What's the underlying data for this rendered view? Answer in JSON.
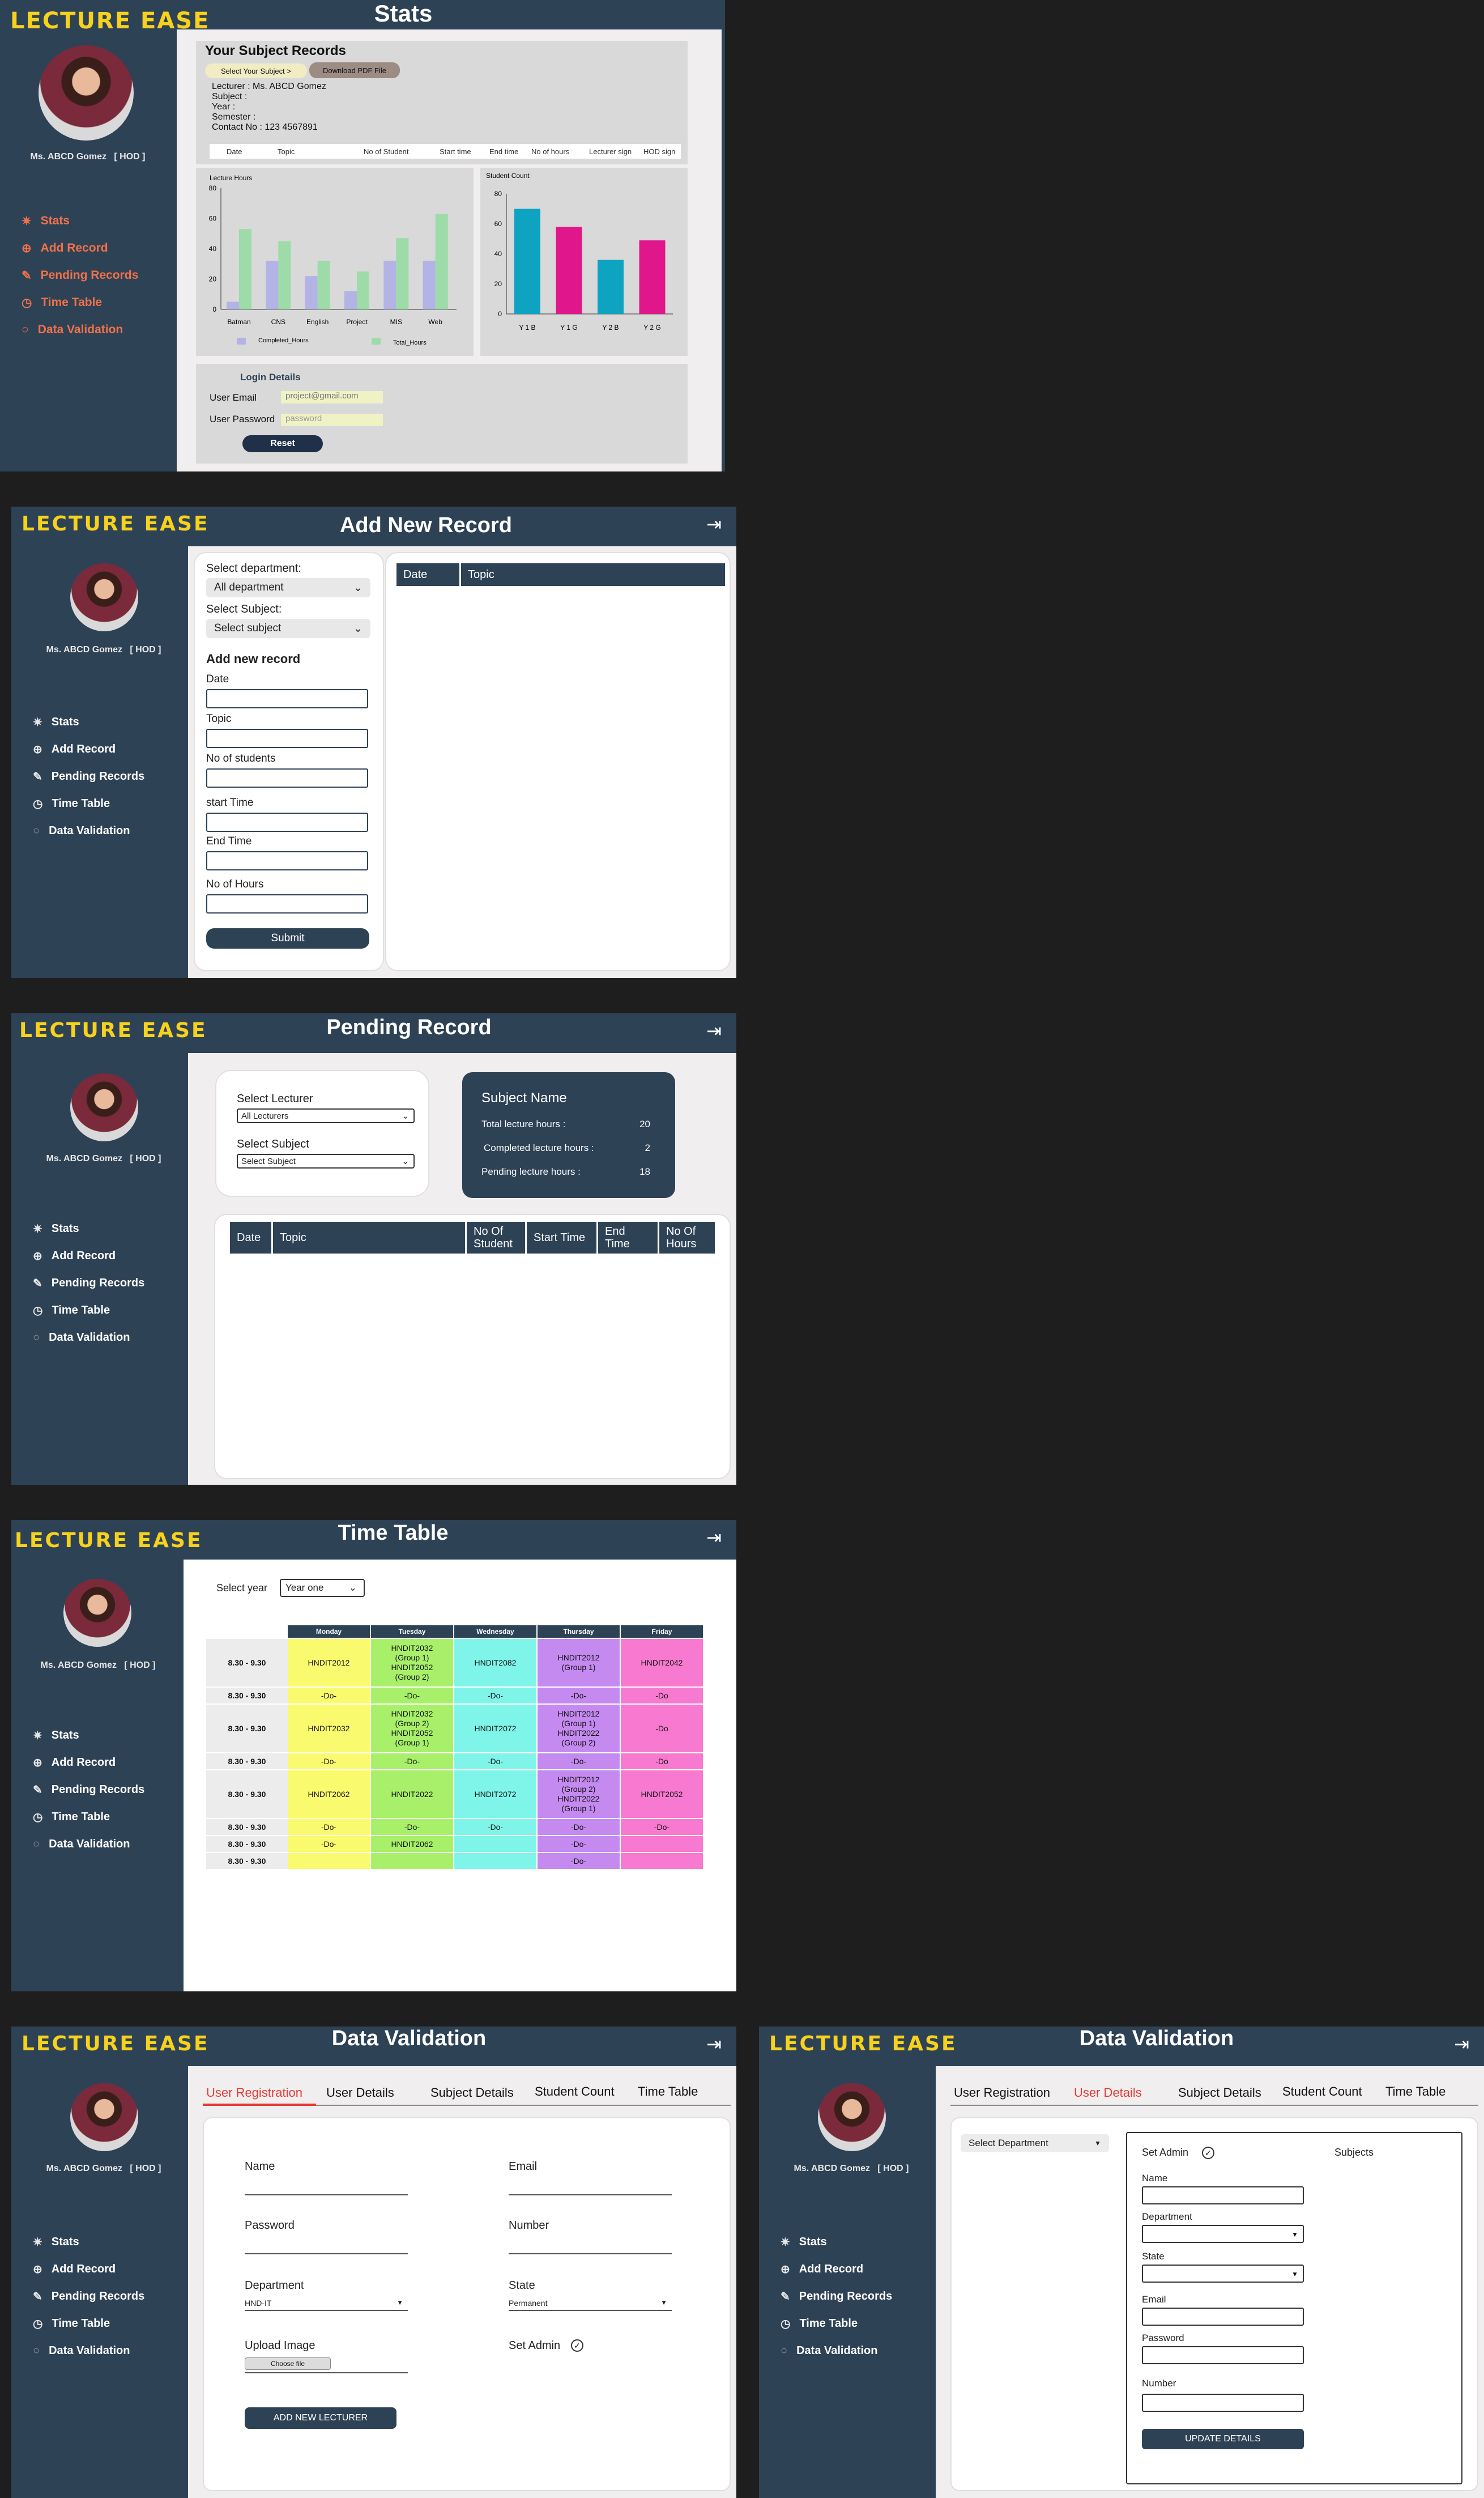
{
  "brand": {
    "name": "LECTURE EASE",
    "color": "#f7d21c"
  },
  "user": {
    "name": "Ms. ABCD Gomez",
    "role": "[ HOD ]"
  },
  "menu": [
    {
      "label": "Stats",
      "icon": "star-icon"
    },
    {
      "label": "Add Record",
      "icon": "plus-circle-icon"
    },
    {
      "label": "Pending Records",
      "icon": "edit-icon"
    },
    {
      "label": "Time Table",
      "icon": "clock-icon"
    },
    {
      "label": "Data Validation",
      "icon": "check-circle-icon"
    }
  ],
  "colors": {
    "sidebar": "#2e4256",
    "accent_orange": "#f0714a",
    "accent_red": "#e53935"
  },
  "stats": {
    "title": "Stats",
    "records_title": "Your Subject Records",
    "select_subject": "Select Your Subject >",
    "download_pdf": "Download PDF File",
    "lecturer_line": "Lecturer : Ms. ABCD Gomez",
    "subject_line": "Subject :",
    "year_line": "Year :",
    "semester_line": "Semester :",
    "contact_line": "Contact No : 123 4567891",
    "columns": [
      "Date",
      "Topic",
      "No of Student",
      "Start time",
      "End time",
      "No of hours",
      "Lecturer sign",
      "HOD sign"
    ],
    "login_title": "Login Details",
    "email_label": "User Email",
    "email_value": "project@gmail.com",
    "password_label": "User Password",
    "password_value": "password",
    "reset": "Reset"
  },
  "chart_data": [
    {
      "type": "bar",
      "title": "Lecture Hours",
      "categories": [
        "Batman",
        "CNS",
        "English",
        "Project",
        "MIS",
        "Web"
      ],
      "series": [
        {
          "name": "Completed_Hours",
          "values": [
            5,
            32,
            22,
            12,
            32,
            32
          ],
          "color": "#b3b3e6"
        },
        {
          "name": "Total_Hours",
          "values": [
            53,
            45,
            32,
            25,
            47,
            63
          ],
          "color": "#9ddba8"
        }
      ],
      "ylim": [
        0,
        80
      ],
      "yticks": [
        0,
        20,
        40,
        60,
        80
      ],
      "legend": "bottom"
    },
    {
      "type": "bar",
      "title": "Student Count",
      "categories": [
        "Y 1 B",
        "Y 1 G",
        "Y 2 B",
        "Y 2 G"
      ],
      "values": [
        70,
        58,
        36,
        49
      ],
      "colors": [
        "#0fa3c2",
        "#e0168b",
        "#0fa3c2",
        "#e0168b"
      ],
      "ylim": [
        0,
        80
      ],
      "yticks": [
        0,
        20,
        40,
        60,
        80
      ]
    }
  ],
  "add": {
    "title": "Add New Record",
    "dept_label": "Select department:",
    "dept_value": "All department",
    "subject_label": "Select Subject:",
    "subject_value": "Select subject",
    "form_title": "Add new record",
    "fields": [
      "Date",
      "Topic",
      "No of students",
      "start Time",
      "End Time",
      "No of Hours"
    ],
    "submit": "Submit",
    "columns": [
      "Date",
      "Topic"
    ]
  },
  "pending": {
    "title": "Pending Record",
    "lecturer_label": "Select Lecturer",
    "lecturer_value": "All Lecturers",
    "subject_label": "Select Subject",
    "subject_value": "Select Subject",
    "card_title": "Subject Name",
    "total_label": "Total lecture hours :",
    "total_value": "20",
    "completed_label": "Completed lecture hours :",
    "completed_value": "2",
    "pending_label": "Pending lecture hours :",
    "pending_value": "18",
    "columns": [
      "Date",
      "Topic",
      "No Of Student",
      "Start Time",
      "End Time",
      "No Of Hours"
    ]
  },
  "timetable": {
    "title": "Time Table",
    "year_label": "Select year",
    "year_value": "Year one",
    "days": [
      "Monday",
      "Tuesday",
      "Wednesday",
      "Thursday",
      "Friday"
    ],
    "day_colors": [
      "#fafa6e",
      "#a8f06a",
      "#7ff5ea",
      "#c58af0",
      "#f77ad0"
    ],
    "rows": [
      {
        "time": "8.30 - 9.30",
        "cells": [
          "HNDIT2012",
          "HNDIT2032 (Group 1) HNDIT2052 (Group 2)",
          "HNDIT2082",
          "HNDIT2012 (Group 1)",
          "HNDIT2042"
        ]
      },
      {
        "time": "8.30 - 9.30",
        "cells": [
          "-Do-",
          "-Do-",
          "-Do-",
          "-Do-",
          "-Do"
        ]
      },
      {
        "time": "8.30 - 9.30",
        "cells": [
          "HNDIT2032",
          "HNDIT2032 (Group 2) HNDIT2052 (Group 1)",
          "HNDIT2072",
          "HNDIT2012 (Group 1) HNDIT2022 (Group 2)",
          "-Do"
        ]
      },
      {
        "time": "8.30 - 9.30",
        "cells": [
          "-Do-",
          "-Do-",
          "-Do-",
          "-Do-",
          "-Do"
        ]
      },
      {
        "time": "8.30 - 9.30",
        "cells": [
          "HNDIT2062",
          "HNDIT2022",
          "HNDIT2072",
          "HNDIT2012 (Group 2) HNDIT2022 (Group 1)",
          "HNDIT2052"
        ]
      },
      {
        "time": "8.30 - 9.30",
        "cells": [
          "-Do-",
          "-Do-",
          "-Do-",
          "-Do-",
          "-Do-"
        ]
      },
      {
        "time": "8.30 - 9.30",
        "cells": [
          "-Do-",
          "HNDIT2062",
          "",
          "-Do-",
          ""
        ]
      },
      {
        "time": "8.30 - 9.30",
        "cells": [
          "",
          "",
          "",
          "-Do-",
          ""
        ]
      }
    ]
  },
  "validation": {
    "title": "Data Validation",
    "tabs": [
      "User Registration",
      "User Details",
      "Subject Details",
      "Student Count",
      "Time Table"
    ],
    "reg": {
      "name": "Name",
      "email": "Email",
      "password": "Password",
      "number": "Number",
      "department": "Department",
      "department_value": "HND-IT",
      "state": "State",
      "state_value": "Permanent",
      "upload": "Upload Image",
      "choose": "Choose file",
      "set_admin": "Set Admin",
      "add_btn": "ADD NEW LECTURER"
    },
    "details": {
      "dept": "Select Department",
      "set_admin": "Set Admin",
      "subjects": "Subjects",
      "fields": [
        "Name",
        "Department",
        "State",
        "Email",
        "Password",
        "Number"
      ],
      "update_btn": "UPDATE DETAILS"
    }
  }
}
